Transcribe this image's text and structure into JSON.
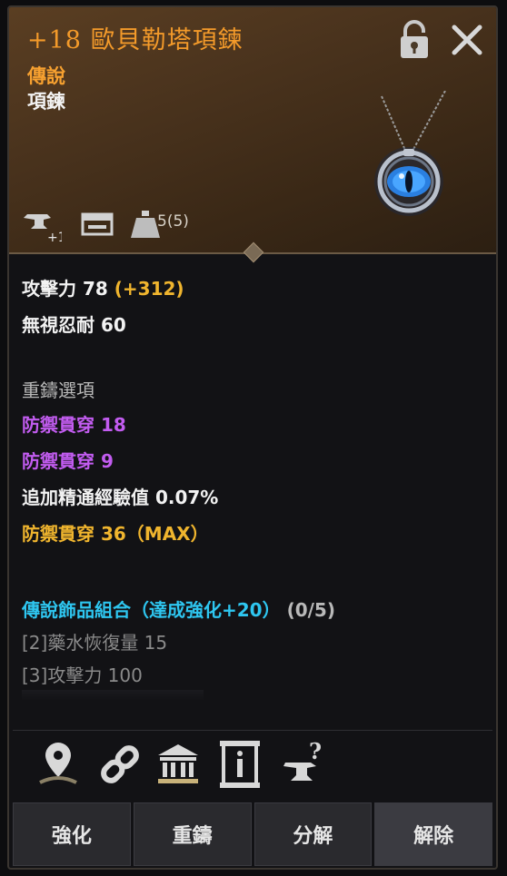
{
  "header": {
    "enhance_level": "+18",
    "item_name": "歐貝勒塔項鍊",
    "grade": "傳說",
    "item_type": "項鍊",
    "slots_text": "5(5)",
    "enhance_badge": "+1"
  },
  "stats": {
    "attack": "攻擊力 78",
    "attack_bonus": "(+312)",
    "ignore_resist": "無視忍耐 60",
    "reforge_header": "重鑄選項",
    "option1": "防禦貫穿 18",
    "option2": "防禦貫穿 9",
    "option3": "追加精通經驗值 0.07%",
    "option4": "防禦貫穿 36（MAX）",
    "set_title": "傳說飾品組合（達成強化+20）",
    "set_count": "(0/5)",
    "set_bonus_2": "[2]藥水恢復量 15",
    "set_bonus_3": "[3]攻擊力 100"
  },
  "buttons": {
    "enhance": "強化",
    "reforge": "重鑄",
    "dismantle": "分解",
    "unequip": "解除"
  },
  "icons": {
    "header": [
      "anvil-plus-icon",
      "chest-icon",
      "weight-icon"
    ],
    "toolbar": [
      "location-pin-icon",
      "link-icon",
      "bank-icon",
      "info-scroll-icon",
      "anvil-question-icon"
    ]
  },
  "colors": {
    "grade_legendary": "#f7a130",
    "purple_option": "#c25cf0",
    "orange_option": "#f0b52e",
    "cyan_set": "#2ec6f0"
  }
}
